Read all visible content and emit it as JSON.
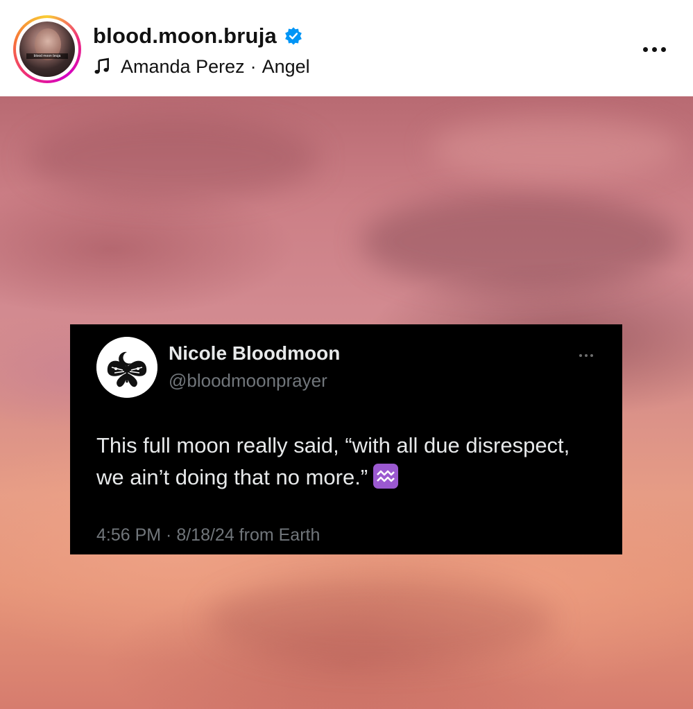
{
  "post": {
    "username": "blood.moon.bruja",
    "verified": true,
    "song_artist": "Amanda Perez",
    "song_separator": "·",
    "song_title": "Angel",
    "avatar_caption": "blood moon bruja"
  },
  "tweet": {
    "display_name": "Nicole Bloodmoon",
    "handle": "@bloodmoonprayer",
    "text": "This full moon really said, “with all due disrespect, we ain’t doing that no more.”",
    "emoji_icon": "aquarius-icon",
    "timestamp": "4:56 PM · 8/18/24 from Earth"
  },
  "colors": {
    "verified_blue": "#0095f6",
    "tweet_bg": "#000000",
    "tweet_text": "#e7e9ea",
    "tweet_muted": "#71767b",
    "aquarius_purple": "#9b59d0"
  }
}
